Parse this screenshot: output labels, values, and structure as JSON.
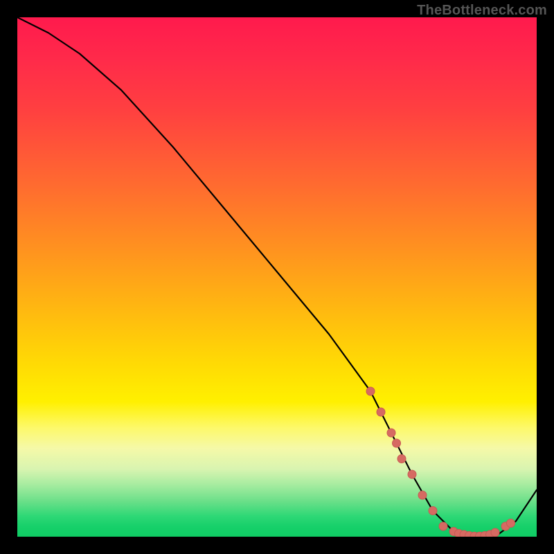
{
  "watermark": "TheBottleneck.com",
  "chart_data": {
    "type": "line",
    "title": "",
    "xlabel": "",
    "ylabel": "",
    "xlim": [
      0,
      100
    ],
    "ylim": [
      0,
      100
    ],
    "series": [
      {
        "name": "curve",
        "x": [
          0,
          6,
          12,
          20,
          30,
          40,
          50,
          60,
          68,
          72,
          76,
          80,
          84,
          88,
          92,
          96,
          100
        ],
        "y": [
          100,
          97,
          93,
          86,
          75,
          63,
          51,
          39,
          28,
          20,
          12,
          5,
          1,
          0,
          0,
          3,
          9
        ]
      }
    ],
    "markers": [
      {
        "x": 68,
        "y": 28
      },
      {
        "x": 70,
        "y": 24
      },
      {
        "x": 72,
        "y": 20
      },
      {
        "x": 73,
        "y": 18
      },
      {
        "x": 74,
        "y": 15
      },
      {
        "x": 76,
        "y": 12
      },
      {
        "x": 78,
        "y": 8
      },
      {
        "x": 80,
        "y": 5
      },
      {
        "x": 82,
        "y": 2
      },
      {
        "x": 84,
        "y": 1
      },
      {
        "x": 85,
        "y": 0.6
      },
      {
        "x": 86,
        "y": 0.4
      },
      {
        "x": 87,
        "y": 0.2
      },
      {
        "x": 88,
        "y": 0.1
      },
      {
        "x": 89,
        "y": 0.1
      },
      {
        "x": 90,
        "y": 0.2
      },
      {
        "x": 91,
        "y": 0.4
      },
      {
        "x": 92,
        "y": 0.8
      },
      {
        "x": 94,
        "y": 2
      },
      {
        "x": 95,
        "y": 2.6
      }
    ],
    "colors": {
      "curve": "#000000",
      "marker_fill": "#d66a62",
      "marker_stroke": "#c85a54"
    }
  }
}
